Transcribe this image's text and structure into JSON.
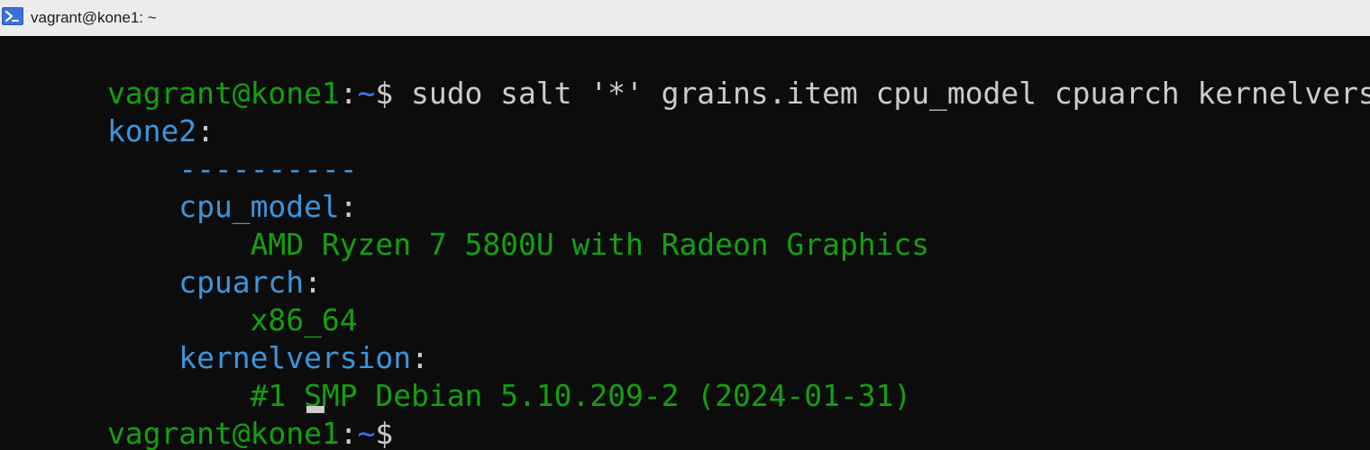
{
  "window": {
    "title": "vagrant@kone1: ~"
  },
  "terminal": {
    "lines": [
      {
        "user_host": "vagrant@kone1",
        "colon": ":",
        "path": "~",
        "prompt_char": "$ ",
        "command": "sudo salt '*' grains.item cpu_model cpuarch kernelversion"
      },
      {
        "text": "kone2",
        "suffix": ":"
      },
      {
        "text": "    ----------"
      },
      {
        "text": "    cpu_model",
        "suffix": ":"
      },
      {
        "text": "        AMD Ryzen 7 5800U with Radeon Graphics"
      },
      {
        "text": "    cpuarch",
        "suffix": ":"
      },
      {
        "text": "        x86_64"
      },
      {
        "text": "    kernelversion",
        "suffix": ":"
      },
      {
        "text": "        #1 SMP Debian 5.10.209-2 (2024-01-31)"
      },
      {
        "user_host": "vagrant@kone1",
        "colon": ":",
        "path": "~",
        "prompt_char": "$ "
      }
    ]
  },
  "icons": {
    "title_icon": "powershell-terminal-icon"
  },
  "colors": {
    "background": "#0c0c0c",
    "prompt_user": "#13a10e",
    "prompt_path": "#3b78ff",
    "key": "#3a96dd",
    "value": "#13a10e",
    "foreground": "#cccccc"
  }
}
